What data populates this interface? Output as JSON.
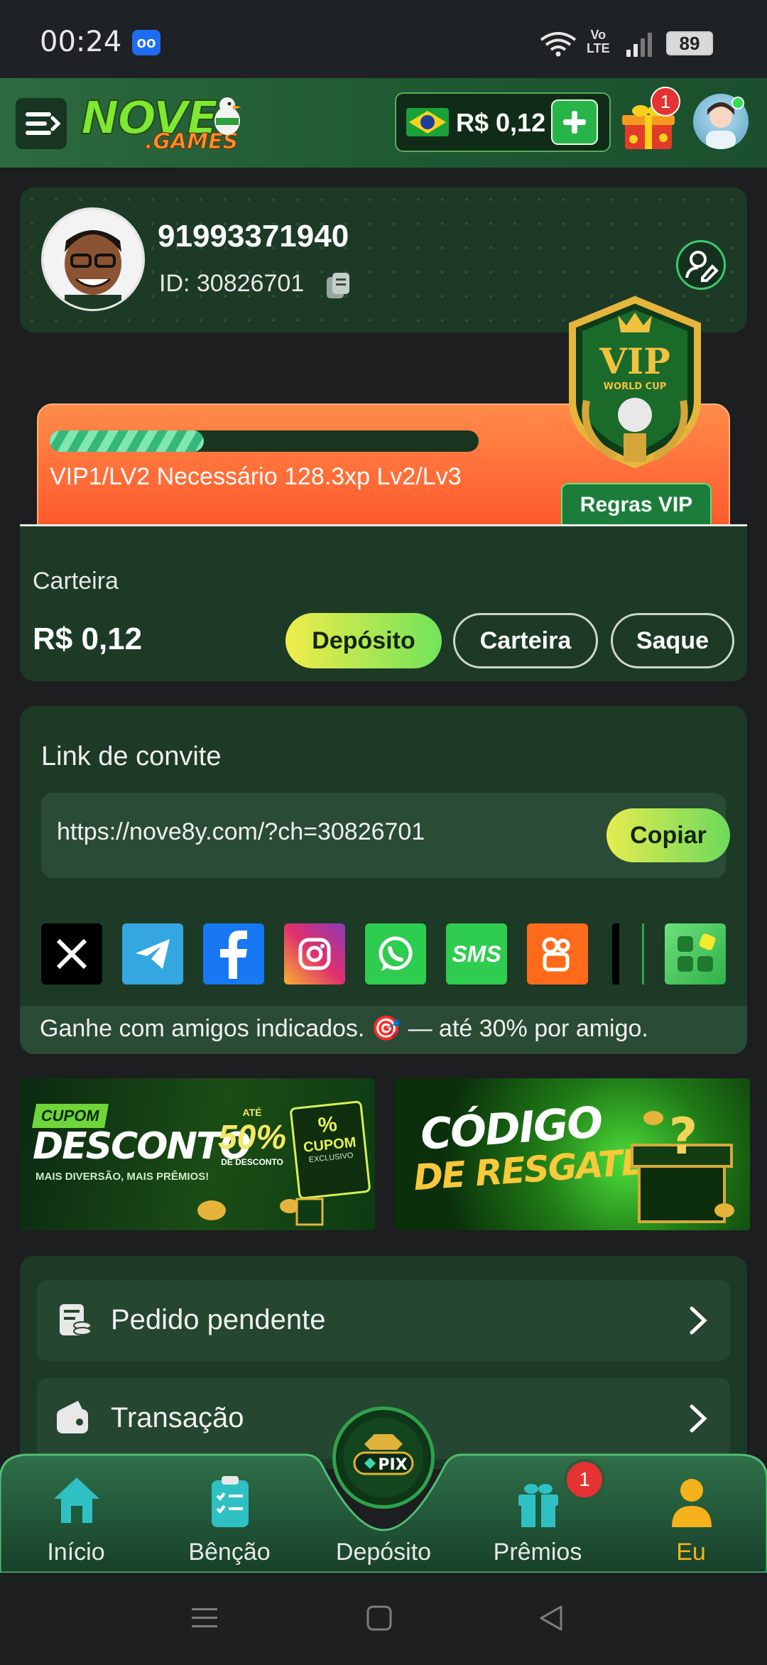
{
  "status_bar": {
    "time": "00:24",
    "network": "Vo\nLTE",
    "battery": "89"
  },
  "header": {
    "logo_main": "NOVE",
    "logo_sub": ".GAMES",
    "balance": "R$ 0,12",
    "gift_badge": "1"
  },
  "profile": {
    "username": "91993371940",
    "id_label": "ID: 30826701"
  },
  "vip": {
    "progress": 0.36,
    "text": "VIP1/LV2 Necessário 128.3xp Lv2/Lv3",
    "rules_button": "Regras VIP",
    "badge_title": "VIP",
    "badge_subtitle": "WORLD CUP"
  },
  "wallet": {
    "label": "Carteira",
    "balance": "R$ 0,12",
    "deposit_button": "Depósito",
    "wallet_button": "Carteira",
    "withdraw_button": "Saque"
  },
  "invite": {
    "title": "Link de convite",
    "url": "https://nove8y.com/?ch=30826701",
    "copy_button": "Copiar",
    "socials": [
      "X",
      "Telegram",
      "Facebook",
      "Instagram",
      "WhatsApp",
      "SMS",
      "Kwai",
      "TikTok",
      "More"
    ],
    "sms_label": "SMS",
    "note": "Ganhe com amigos indicados. 🎯 — até 30% por amigo."
  },
  "banners": {
    "coupon": {
      "tag": "CUPOM",
      "title": "DESCONTO",
      "tagline": "MAIS DIVERSÃO, MAIS PRÊMIOS!",
      "upto": "ATÉ",
      "percent": "50%",
      "discount": "DE DESCONTO",
      "ticket_percent": "%",
      "ticket_label": "CUPOM",
      "ticket_sub": "EXCLUSIVO"
    },
    "code": {
      "line1": "CÓDIGO",
      "line2": "DE RESGATE"
    }
  },
  "menu": {
    "items": [
      {
        "label": "Pedido pendente"
      },
      {
        "label": "Transação"
      }
    ]
  },
  "bottom_nav": {
    "items": [
      {
        "label": "Início"
      },
      {
        "label": "Bênção"
      },
      {
        "label": "Depósito"
      },
      {
        "label": "Prêmios"
      },
      {
        "label": "Eu"
      }
    ],
    "badge": "1",
    "pix_label": "PIX"
  },
  "colors": {
    "accent_green": "#2ea24c",
    "active_tab": "#f5b21b",
    "header_bg": "#2d6a3f",
    "vip_orange": "#ff6a35"
  }
}
